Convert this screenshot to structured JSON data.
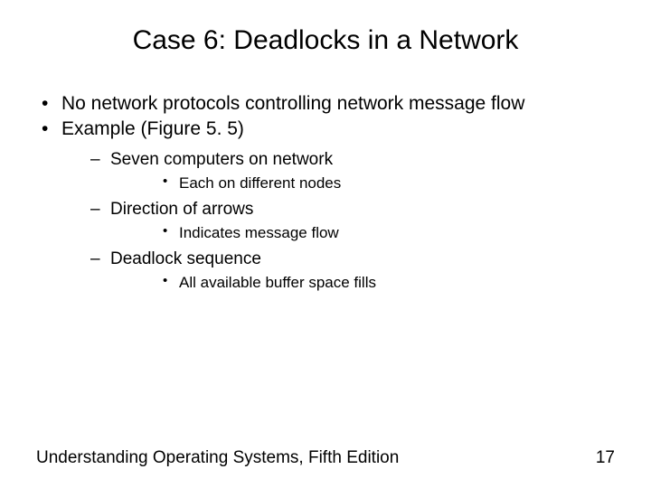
{
  "title": "Case 6: Deadlocks in a Network",
  "bullets": {
    "b1": "No network protocols controlling network message flow",
    "b2": "Example (Figure 5. 5)",
    "s1": "Seven computers on network",
    "s1a": "Each on different nodes",
    "s2": "Direction of arrows",
    "s2a": "Indicates message flow",
    "s3": "Deadlock sequence",
    "s3a": "All available buffer space fills"
  },
  "footer": {
    "source": "Understanding Operating Systems, Fifth Edition",
    "page": "17"
  }
}
